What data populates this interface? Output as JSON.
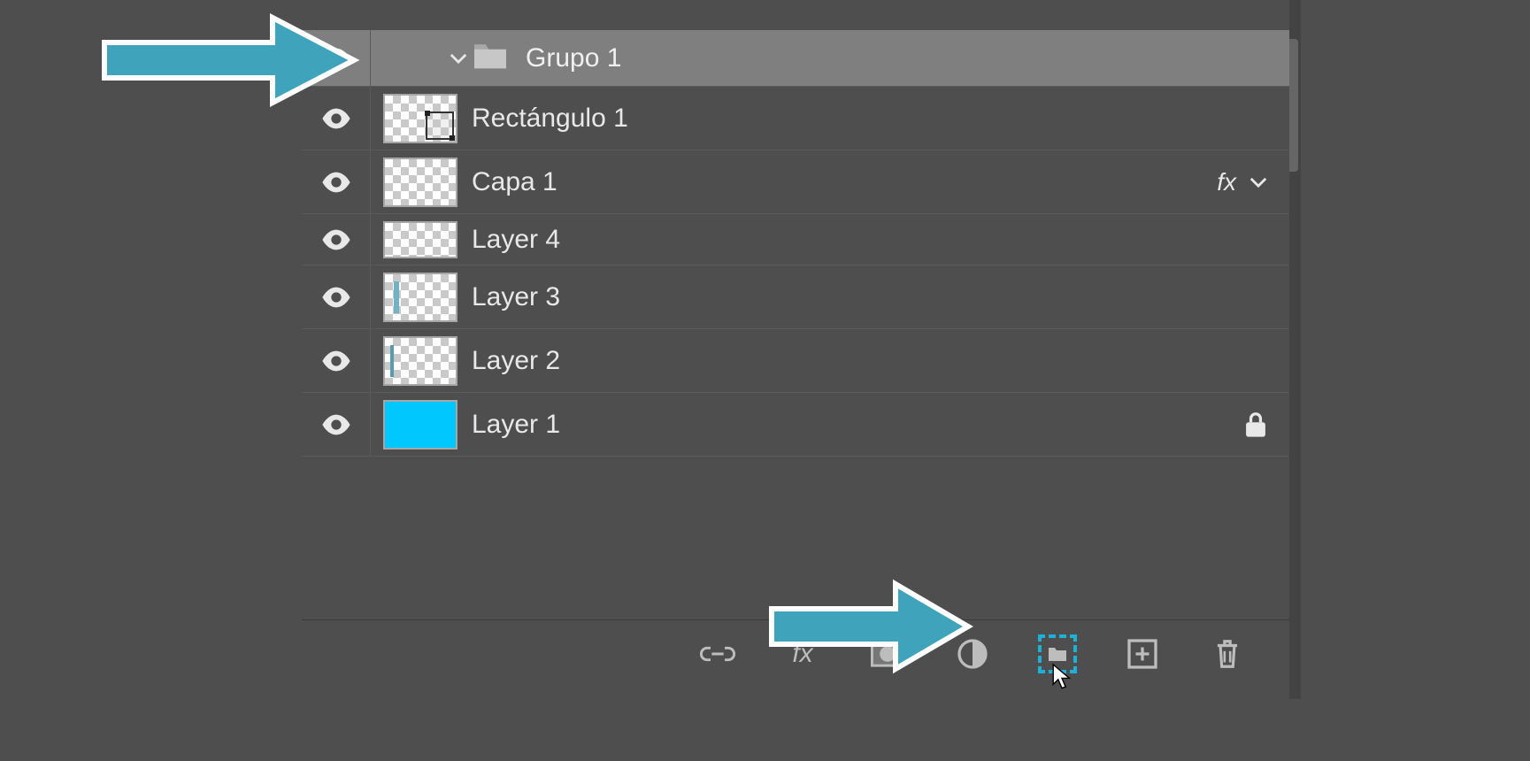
{
  "colors": {
    "accent": "#1fb0d6",
    "cyan_fill": "#00c8ff",
    "panel_bg": "#4e4e4e",
    "selected_bg": "#7f7f7f",
    "text": "#e8e8e8"
  },
  "group": {
    "name": "Grupo 1",
    "expanded": true
  },
  "layers": [
    {
      "name": "Rectángulo 1",
      "thumb": "shape",
      "fx": false,
      "locked": false
    },
    {
      "name": "Capa 1",
      "thumb": "checker",
      "fx": true,
      "locked": false
    },
    {
      "name": "Layer 4",
      "thumb": "checker",
      "fx": false,
      "locked": false
    },
    {
      "name": "Layer 3",
      "thumb": "checker_stripe",
      "fx": false,
      "locked": false
    },
    {
      "name": "Layer 2",
      "thumb": "checker_stripe",
      "fx": false,
      "locked": false
    },
    {
      "name": "Layer 1",
      "thumb": "solid_cyan",
      "fx": false,
      "locked": true
    }
  ],
  "bottom_bar": {
    "buttons": [
      "link",
      "fx",
      "mask",
      "adjustment",
      "new-group",
      "new-layer",
      "delete"
    ]
  },
  "labels": {
    "fx": "fx"
  }
}
